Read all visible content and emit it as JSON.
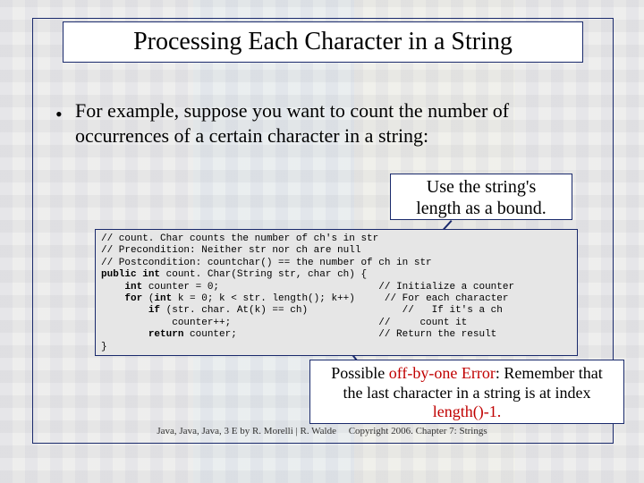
{
  "title": "Processing Each Character in a String",
  "bullet": {
    "text": "For example, suppose you want to count the number of occurrences of a certain character in a string:"
  },
  "callout1": {
    "line1": "Use the string's",
    "line2": "length as a bound."
  },
  "code": {
    "c1": "// count. Char counts the number of ch's in str",
    "c2": "// Precondition: Neither str nor ch are null",
    "c3": "// Postcondition: countchar() == the number of ch in str",
    "kw_public": "public",
    "kw_int": "int",
    "sig": " count. Char(String str, char ch) {",
    "l5a": "    ",
    "l5_kw": "int",
    "l5b": " counter = 0;                           // Initialize a counter",
    "l6a": "    ",
    "l6_kw": "for",
    "l6b": " (",
    "l6_kw2": "int",
    "l6c": " k = 0; k < str. length(); k++)     // For each character",
    "l7a": "        ",
    "l7_kw": "if",
    "l7b": " (str. char. At(k) == ch)                //   If it's a ch",
    "l8": "            counter++;                         //     count it",
    "l9a": "        ",
    "l9_kw": "return",
    "l9b": " counter;                        // Return the result",
    "l10": "}"
  },
  "callout2": {
    "line1_a": "Possible ",
    "line1_red": "off-by-one Error",
    "line1_b": ": Remember that",
    "line2": "the last character in a string is at index",
    "line3_red": "length()-1."
  },
  "footer": {
    "left": "Java, Java, Java, 3 E by R. Morelli | R. Walde",
    "right": "Copyright 2006.  Chapter 7: Strings"
  }
}
